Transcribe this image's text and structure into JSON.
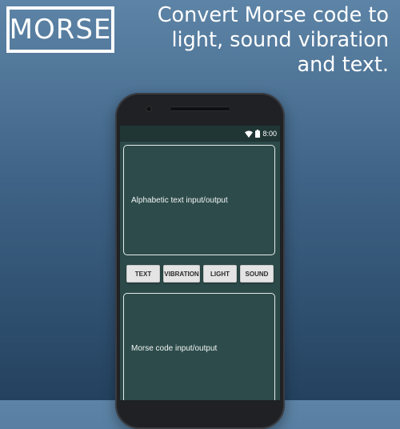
{
  "logo": {
    "text": "MORSE"
  },
  "tagline": {
    "lines": [
      "Convert Morse code to",
      "light, sound vibration",
      "and text."
    ]
  },
  "statusbar": {
    "time": "8:00"
  },
  "app": {
    "text_panel_label": "Alphabetic text input/output",
    "morse_panel_label": "Morse code input/output",
    "buttons": {
      "text": "TEXT",
      "vibration": "VIBRATION",
      "light": "LIGHT",
      "sound": "SOUND"
    }
  },
  "colors": {
    "background_top": "#5d84a6",
    "background_bottom": "#24425f",
    "screen": "#2c4a49",
    "button": "#e4e4e4"
  },
  "icons": [
    "wifi-icon",
    "battery-icon",
    "camera-icon",
    "speaker-icon"
  ]
}
